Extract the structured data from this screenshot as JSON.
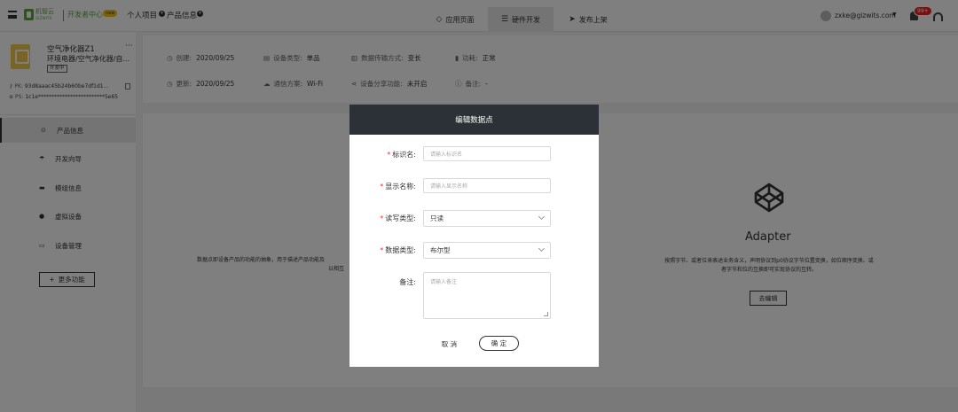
{
  "topbar": {
    "logo_text": "机智云",
    "logo_sub": "GIZWITS",
    "dev_center": "开发者中心",
    "new_badge": "new",
    "crumb_project": "个人项目",
    "crumb_product": "产品信息",
    "tabs": [
      {
        "label": "应用页面",
        "icon": "diamond-icon"
      },
      {
        "label": "硬件开发",
        "icon": "sliders-icon",
        "active": true
      },
      {
        "label": "发布上架",
        "icon": "send-icon"
      }
    ],
    "email": "zxke@gizwits.com",
    "notify_count": "99+"
  },
  "sidebar": {
    "product_name": "空气净化器Z1",
    "product_more": "···",
    "product_category": "环境电器/空气净化器/自...",
    "product_state": "开发中",
    "pk_label": "PK:",
    "pk_value": "93d8aaac45b24b60be7df1d1...",
    "ps_label": "PS:",
    "ps_value": "1c1e*************************5e65",
    "items": [
      {
        "label": "产品信息",
        "icon": "info-icon",
        "active": true
      },
      {
        "label": "开发向导",
        "icon": "umbrella-icon"
      },
      {
        "label": "模组信息",
        "icon": "module-icon"
      },
      {
        "label": "虚拟设备",
        "icon": "device-icon"
      },
      {
        "label": "设备管理",
        "icon": "box-icon"
      }
    ],
    "more_button": "更多功能"
  },
  "info": {
    "created_label": "创建:",
    "created_value": "2020/09/25",
    "device_type_label": "设备类型:",
    "device_type_value": "单品",
    "transfer_label": "数据传输方式:",
    "transfer_value": "变长",
    "power_label": "功耗:",
    "power_value": "正常",
    "updated_label": "更新:",
    "updated_value": "2020/09/25",
    "comm_label": "通信方案:",
    "comm_value": "Wi-Fi",
    "share_label": "设备分享功能:",
    "share_value": "未开启",
    "remark_label": "备注:",
    "remark_value": "-"
  },
  "content": {
    "left_desc_1": "数据点即设备产品的功能的抽象，用于描述产品功能及",
    "left_desc_2": "以相互",
    "adapter_title": "Adapter",
    "adapter_desc_1": "按照字节、或者位来表述业务含义，声明协议到p0协议字节位置变换，如位顺序变换、或",
    "adapter_desc_2": "者字节和位的互换即可实现协议的互转。",
    "adapter_button": "去编辑"
  },
  "modal": {
    "title": "编辑数据点",
    "fields": {
      "identifier_label": "标识名:",
      "identifier_placeholder": "请输入标识名",
      "display_label": "显示名称:",
      "display_placeholder": "请输入显示名称",
      "rw_label": "读写类型:",
      "rw_value": "只读",
      "dtype_label": "数据类型:",
      "dtype_value": "布尔型",
      "remark_label": "备注:",
      "remark_placeholder": "请输入备注"
    },
    "required_mark": "*",
    "cancel": "取 消",
    "confirm": "确 定"
  },
  "colors": {
    "brand_green": "#5aa83a",
    "modal_header": "#2b3136",
    "badge_red": "#e22",
    "required_red": "#e33"
  }
}
